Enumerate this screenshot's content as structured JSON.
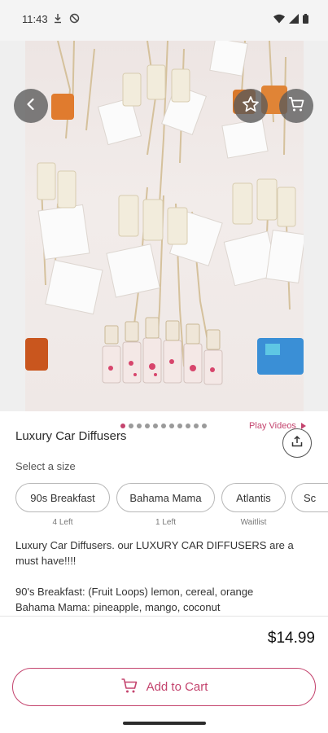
{
  "status_bar": {
    "time": "11:43",
    "left_icons": [
      "download-icon",
      "do-not-disturb-icon"
    ],
    "right_icons": [
      "wifi-icon",
      "signal-icon",
      "battery-icon"
    ]
  },
  "hero": {
    "pager": {
      "count": 11,
      "active_index": 0
    },
    "play_videos_label": "Play Videos"
  },
  "product": {
    "title": "Luxury Car Diffusers",
    "size_prompt": "Select a size",
    "sizes": [
      {
        "label": "90s Breakfast",
        "availability": "4 Left"
      },
      {
        "label": "Bahama Mama",
        "availability": "1 Left"
      },
      {
        "label": "Atlantis",
        "availability": "Waitlist"
      },
      {
        "label": "Sc",
        "availability": ""
      }
    ],
    "description": [
      "Luxury Car Diffusers. our LUXURY CAR DIFFUSERS are a must have!!!!",
      "",
      "90's Breakfast: (Fruit Loops) lemon, cereal, orange",
      "Bahama Mama: pineapple, mango, coconut"
    ],
    "price": "$14.99",
    "add_to_cart_label": "Add to Cart"
  },
  "colors": {
    "accent": "#c4446e",
    "button_overlay": "#5a5a5a",
    "chip_border": "#b7b7b7"
  }
}
